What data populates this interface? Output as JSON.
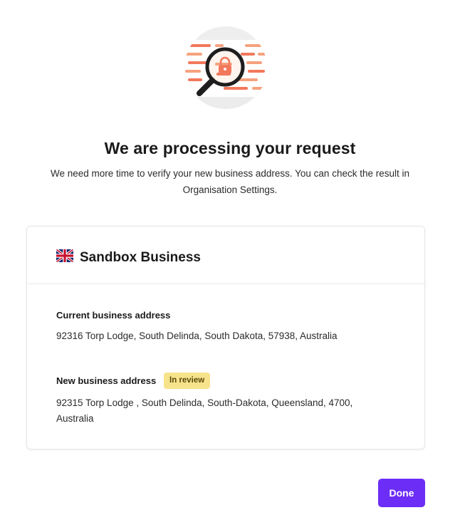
{
  "header": {
    "title": "We are processing your request",
    "subtitle": "We need more time to verify your new business address. You can check the result in Organisation Settings."
  },
  "card": {
    "flag_icon": "uk-flag-icon",
    "business_name": "Sandbox Business",
    "current_address": {
      "label": "Current business address",
      "value": "92316 Torp Lodge, South Delinda, South Dakota, 57938, Australia"
    },
    "new_address": {
      "label": "New business address",
      "badge": "In review",
      "value": "92315 Torp Lodge , South Delinda, South-Dakota, Queensland, 4700, Australia"
    }
  },
  "actions": {
    "done_label": "Done"
  },
  "colors": {
    "primary": "#6c2df7",
    "badge_bg": "#f7e38c",
    "illustration_accent": "#f2785c"
  }
}
